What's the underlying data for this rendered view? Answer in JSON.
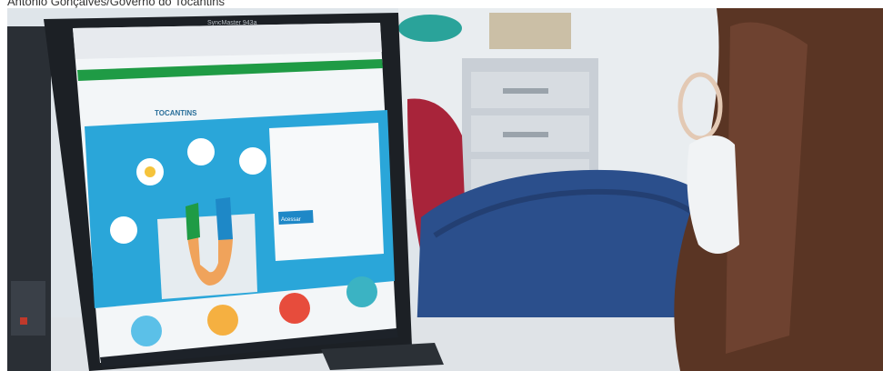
{
  "caption": "Antonio Gonçalves/Governo do Tocantins",
  "monitor": {
    "brand": "SyncMaster 943a"
  },
  "screen": {
    "site_name": "TOCANTINS",
    "login_button": "Acessar"
  },
  "colors": {
    "screen_cyan": "#2aa6d9",
    "site_green": "#1f9b45",
    "chair_blue": "#2b4f8c",
    "wall": "#e8ecef"
  }
}
